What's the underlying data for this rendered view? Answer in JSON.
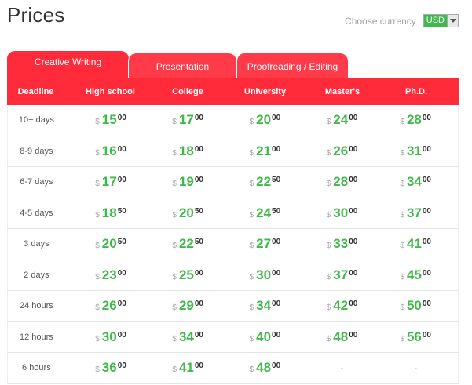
{
  "title": "Prices",
  "currency": {
    "label": "Choose currency",
    "selected": "USD"
  },
  "tabs": [
    {
      "label": "Creative Writing",
      "active": true
    },
    {
      "label": "Presentation",
      "active": false
    },
    {
      "label": "Proofreading / Editing",
      "active": false
    }
  ],
  "columns": [
    "Deadline",
    "High school",
    "College",
    "University",
    "Master's",
    "Ph.D."
  ],
  "currency_symbol": "$",
  "rows": [
    {
      "deadline": "10+ days",
      "prices": [
        {
          "int": "15",
          "dec": "00"
        },
        {
          "int": "17",
          "dec": "00"
        },
        {
          "int": "20",
          "dec": "00"
        },
        {
          "int": "24",
          "dec": "00"
        },
        {
          "int": "28",
          "dec": "00"
        }
      ]
    },
    {
      "deadline": "8-9 days",
      "prices": [
        {
          "int": "16",
          "dec": "00"
        },
        {
          "int": "18",
          "dec": "00"
        },
        {
          "int": "21",
          "dec": "00"
        },
        {
          "int": "26",
          "dec": "00"
        },
        {
          "int": "31",
          "dec": "00"
        }
      ]
    },
    {
      "deadline": "6-7 days",
      "prices": [
        {
          "int": "17",
          "dec": "00"
        },
        {
          "int": "19",
          "dec": "00"
        },
        {
          "int": "22",
          "dec": "50"
        },
        {
          "int": "28",
          "dec": "00"
        },
        {
          "int": "34",
          "dec": "00"
        }
      ]
    },
    {
      "deadline": "4-5 days",
      "prices": [
        {
          "int": "18",
          "dec": "50"
        },
        {
          "int": "20",
          "dec": "50"
        },
        {
          "int": "24",
          "dec": "50"
        },
        {
          "int": "30",
          "dec": "00"
        },
        {
          "int": "37",
          "dec": "00"
        }
      ]
    },
    {
      "deadline": "3 days",
      "prices": [
        {
          "int": "20",
          "dec": "50"
        },
        {
          "int": "22",
          "dec": "50"
        },
        {
          "int": "27",
          "dec": "00"
        },
        {
          "int": "33",
          "dec": "00"
        },
        {
          "int": "41",
          "dec": "00"
        }
      ]
    },
    {
      "deadline": "2 days",
      "prices": [
        {
          "int": "23",
          "dec": "00"
        },
        {
          "int": "25",
          "dec": "00"
        },
        {
          "int": "30",
          "dec": "00"
        },
        {
          "int": "37",
          "dec": "00"
        },
        {
          "int": "45",
          "dec": "00"
        }
      ]
    },
    {
      "deadline": "24 hours",
      "prices": [
        {
          "int": "26",
          "dec": "00"
        },
        {
          "int": "29",
          "dec": "00"
        },
        {
          "int": "34",
          "dec": "00"
        },
        {
          "int": "42",
          "dec": "00"
        },
        {
          "int": "50",
          "dec": "00"
        }
      ]
    },
    {
      "deadline": "12 hours",
      "prices": [
        {
          "int": "30",
          "dec": "00"
        },
        {
          "int": "34",
          "dec": "00"
        },
        {
          "int": "40",
          "dec": "00"
        },
        {
          "int": "48",
          "dec": "00"
        },
        {
          "int": "56",
          "dec": "00"
        }
      ]
    },
    {
      "deadline": "6 hours",
      "prices": [
        {
          "int": "36",
          "dec": "00"
        },
        {
          "int": "41",
          "dec": "00"
        },
        {
          "int": "48",
          "dec": "00"
        },
        null,
        null
      ]
    }
  ],
  "unavailable_mark": "-"
}
